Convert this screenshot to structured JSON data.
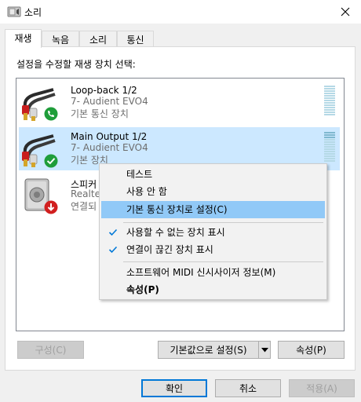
{
  "window": {
    "title": "소리"
  },
  "tabs": [
    {
      "label": "재생",
      "active": true
    },
    {
      "label": "녹음",
      "active": false
    },
    {
      "label": "소리",
      "active": false
    },
    {
      "label": "통신",
      "active": false
    }
  ],
  "instruction": "설정을 수정할 재생 장치 선택:",
  "devices": [
    {
      "name": "Loop-back 1/2",
      "driver": "7- Audient EVO4",
      "status": "기본 통신 장치",
      "badge": "phone-badge-icon",
      "selected": false
    },
    {
      "name": "Main Output 1/2",
      "driver": "7- Audient EVO4",
      "status": "기본 장치",
      "badge": "check-badge-icon",
      "selected": true
    },
    {
      "name": "스피커",
      "driver": "Realtek",
      "status": "연결되",
      "badge": "down-arrow-badge-icon",
      "selected": false
    }
  ],
  "context_menu": {
    "items": [
      {
        "label": "테스트"
      },
      {
        "label": "사용 안 함"
      },
      {
        "label": "기본 통신 장치로 설정(C)",
        "highlighted": true
      },
      {
        "label": "사용할 수 없는 장치 표시",
        "checked": true
      },
      {
        "label": "연결이 끊긴 장치 표시",
        "checked": true
      },
      {
        "label": "소프트웨어 MIDI 신시사이저 정보(M)"
      },
      {
        "label": "속성(P)",
        "bold": true
      }
    ]
  },
  "buttons": {
    "configure": "구성(C)",
    "set_default": "기본값으로 설정(S)",
    "properties": "속성(P)",
    "ok": "확인",
    "cancel": "취소",
    "apply": "적용(A)"
  },
  "colors": {
    "selection": "#cce8ff",
    "menu_highlight": "#91c9f7",
    "accent": "#0078d7",
    "check_badge": "#1f9d3a",
    "down_badge": "#d11f1f"
  }
}
